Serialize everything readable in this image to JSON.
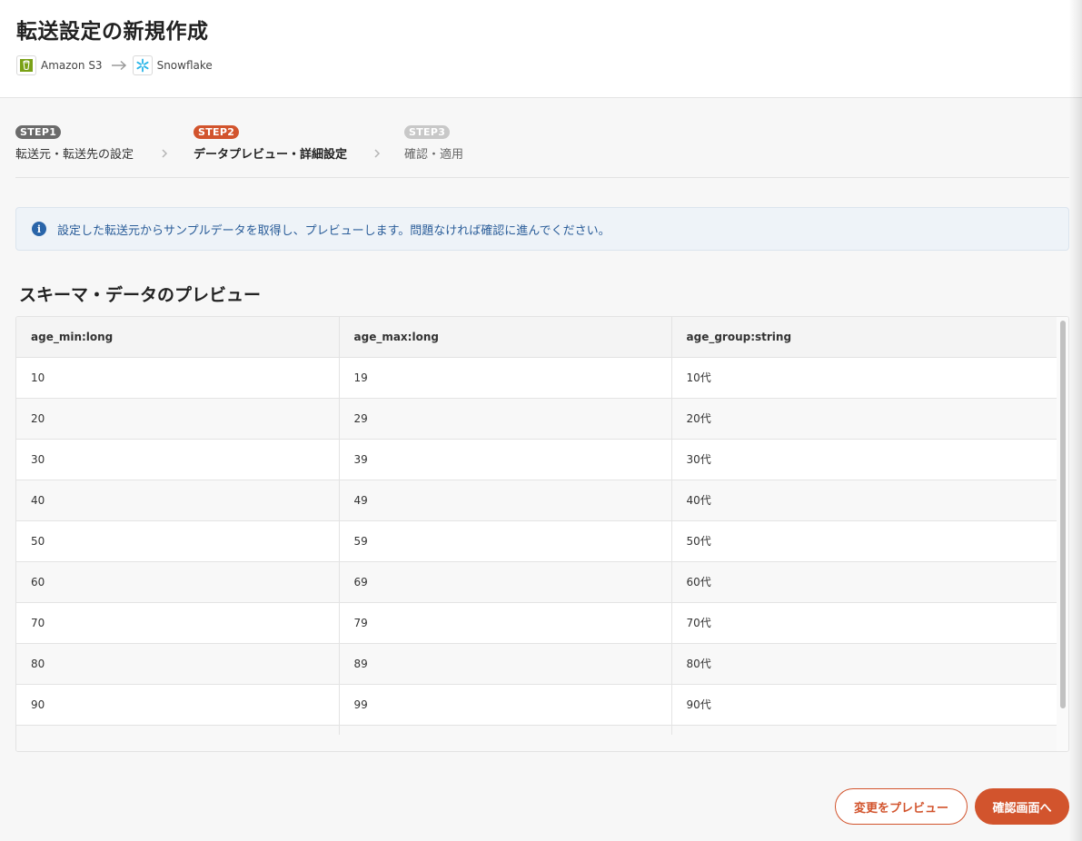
{
  "header": {
    "title": "転送設定の新規作成",
    "source": {
      "label": "Amazon S3",
      "icon": "amazon-s3-icon"
    },
    "destination": {
      "label": "Snowflake",
      "icon": "snowflake-icon"
    }
  },
  "steps": [
    {
      "badge": "STEP1",
      "label": "転送元・転送先の設定",
      "state": "done",
      "color": "#6b6b6b"
    },
    {
      "badge": "STEP2",
      "label": "データプレビュー・詳細設定",
      "state": "active",
      "color": "#d2542d"
    },
    {
      "badge": "STEP3",
      "label": "確認・適用",
      "state": "inactive",
      "color": "#c8c8c8"
    }
  ],
  "info": {
    "text": "設定した転送元からサンプルデータを取得し、プレビューします。問題なければ確認に進んでください。"
  },
  "preview": {
    "title": "スキーマ・データのプレビュー",
    "columns": [
      "age_min:long",
      "age_max:long",
      "age_group:string"
    ],
    "rows": [
      [
        "10",
        "19",
        "10代"
      ],
      [
        "20",
        "29",
        "20代"
      ],
      [
        "30",
        "39",
        "30代"
      ],
      [
        "40",
        "49",
        "40代"
      ],
      [
        "50",
        "59",
        "50代"
      ],
      [
        "60",
        "69",
        "60代"
      ],
      [
        "70",
        "79",
        "70代"
      ],
      [
        "80",
        "89",
        "80代"
      ],
      [
        "90",
        "99",
        "90代"
      ]
    ]
  },
  "actions": {
    "preview_changes": "変更をプレビュー",
    "to_confirm": "確認画面へ"
  },
  "colors": {
    "accent": "#d2542d",
    "info_text": "#2a5d99",
    "info_icon": "#2a65a9"
  }
}
